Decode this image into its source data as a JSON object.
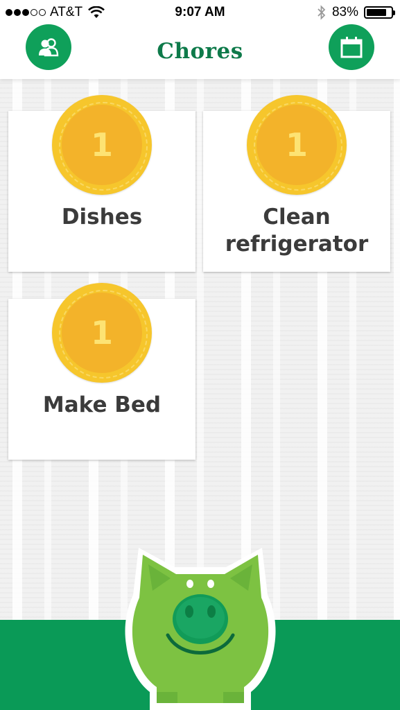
{
  "status_bar": {
    "carrier": "AT&T",
    "time": "9:07 AM",
    "battery_percent": "83%",
    "battery_level": 0.83,
    "signal_bars_filled": 3,
    "signal_bars_total": 5
  },
  "nav": {
    "title": "Chores",
    "left_icon": "users-icon",
    "right_icon": "calendar-icon"
  },
  "chores": [
    {
      "name": "Dishes",
      "coins": "1"
    },
    {
      "name": "Clean refrigerator",
      "coins": "1"
    },
    {
      "name": "Make Bed",
      "coins": "1"
    }
  ],
  "bottom": {
    "mascot_icon": "piggy-bank-icon"
  },
  "colors": {
    "brand_green": "#0a9a57",
    "title_green": "#0e7a4a",
    "coin_gold": "#f6c62c",
    "pig_green": "#7dc242"
  }
}
